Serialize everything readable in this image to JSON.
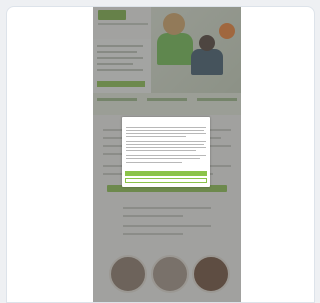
{
  "site": {
    "logo_text": "",
    "hero_headline": "",
    "badge_text": ""
  },
  "consent_dialog": {
    "title": "",
    "accept_label": "",
    "settings_label": ""
  },
  "experts_section": {
    "heading": ""
  },
  "colors": {
    "brand_green": "#8bc34a",
    "badge_orange": "#f07f2c",
    "overlay": "rgba(80,80,80,0.5)"
  }
}
